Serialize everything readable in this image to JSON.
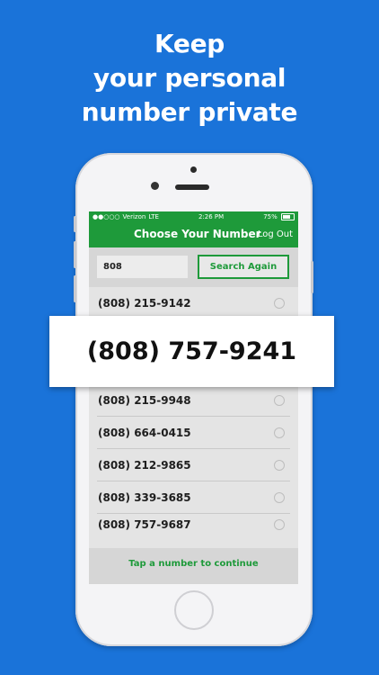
{
  "headline": [
    "Keep",
    "your personal",
    "number private"
  ],
  "status_bar": {
    "carrier": "Verizon",
    "network": "LTE",
    "time": "2:26 PM",
    "battery": "75%"
  },
  "nav": {
    "title": "Choose Your Number",
    "logout_label": "Log Out"
  },
  "search": {
    "value": "808",
    "button_label": "Search Again"
  },
  "numbers": [
    "(808) 215-9142",
    "(808) 215-9948",
    "(808) 664-0415",
    "(808) 212-9865",
    "(808) 339-3685",
    "(808) 757-9687"
  ],
  "highlighted_number": "(808) 757-9241",
  "footer_text": "Tap a number to continue",
  "colors": {
    "background": "#1a73d9",
    "accent": "#1e9a3a"
  }
}
